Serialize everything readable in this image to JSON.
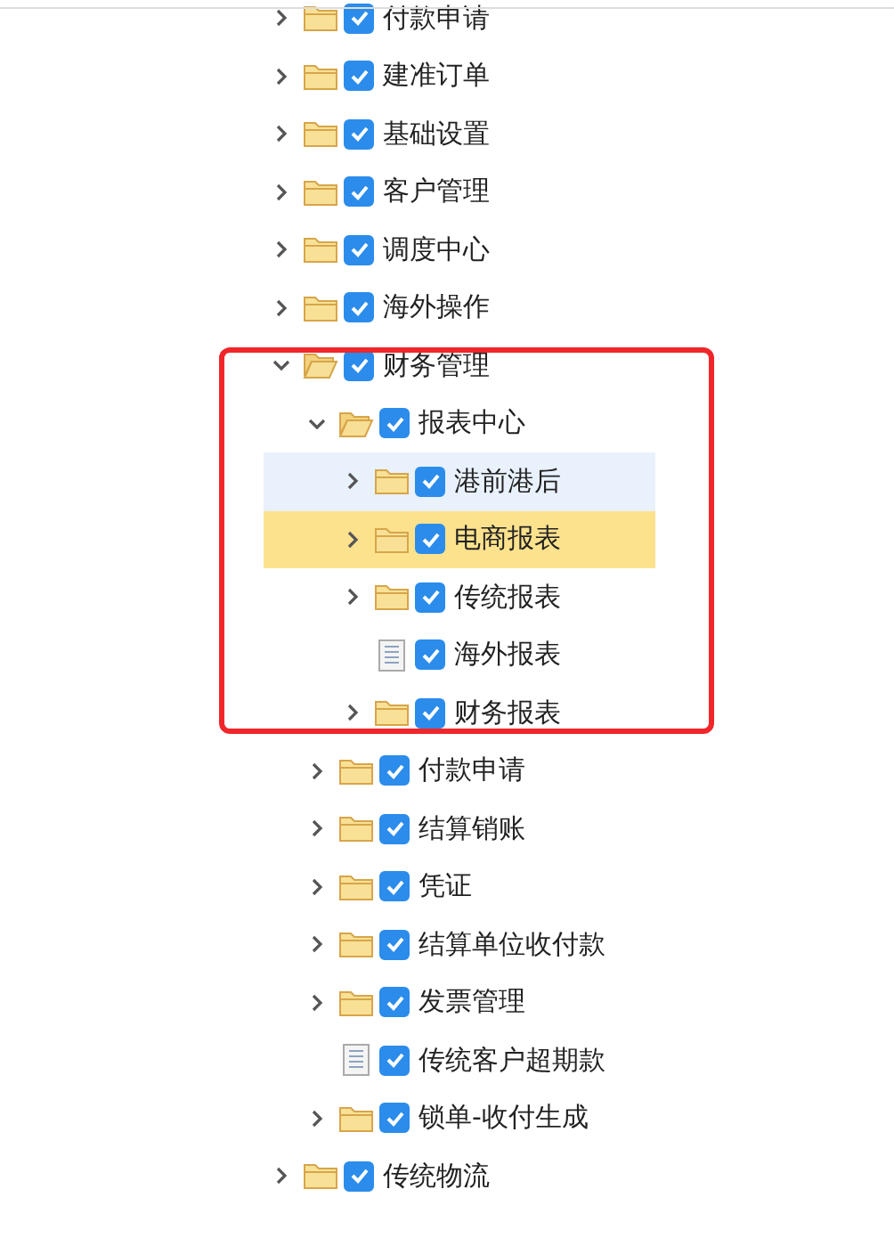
{
  "tree": [
    {
      "label": "付款申请",
      "kind": "folder",
      "expanded": false,
      "checked": true,
      "selected": false,
      "hovered": false
    },
    {
      "label": "建准订单",
      "kind": "folder",
      "expanded": false,
      "checked": true,
      "selected": false,
      "hovered": false
    },
    {
      "label": "基础设置",
      "kind": "folder",
      "expanded": false,
      "checked": true,
      "selected": false,
      "hovered": false
    },
    {
      "label": "客户管理",
      "kind": "folder",
      "expanded": false,
      "checked": true,
      "selected": false,
      "hovered": false
    },
    {
      "label": "调度中心",
      "kind": "folder",
      "expanded": false,
      "checked": true,
      "selected": false,
      "hovered": false
    },
    {
      "label": "海外操作",
      "kind": "folder",
      "expanded": false,
      "checked": true,
      "selected": false,
      "hovered": false
    },
    {
      "label": "财务管理",
      "kind": "folder",
      "expanded": true,
      "checked": true,
      "selected": false,
      "hovered": false,
      "children": [
        {
          "label": "报表中心",
          "kind": "folder",
          "expanded": true,
          "checked": true,
          "selected": false,
          "hovered": false,
          "children": [
            {
              "label": "港前港后",
              "kind": "folder",
              "expanded": false,
              "checked": true,
              "selected": false,
              "hovered": true
            },
            {
              "label": "电商报表",
              "kind": "folder",
              "expanded": false,
              "checked": true,
              "selected": true,
              "hovered": false
            },
            {
              "label": "传统报表",
              "kind": "folder",
              "expanded": false,
              "checked": true,
              "selected": false,
              "hovered": false
            },
            {
              "label": "海外报表",
              "kind": "file",
              "checked": true,
              "selected": false,
              "hovered": false
            },
            {
              "label": "财务报表",
              "kind": "folder",
              "expanded": false,
              "checked": true,
              "selected": false,
              "hovered": false
            }
          ]
        },
        {
          "label": "付款申请",
          "kind": "folder",
          "expanded": false,
          "checked": true,
          "selected": false,
          "hovered": false
        },
        {
          "label": "结算销账",
          "kind": "folder",
          "expanded": false,
          "checked": true,
          "selected": false,
          "hovered": false
        },
        {
          "label": "凭证",
          "kind": "folder",
          "expanded": false,
          "checked": true,
          "selected": false,
          "hovered": false
        },
        {
          "label": "结算单位收付款",
          "kind": "folder",
          "expanded": false,
          "checked": true,
          "selected": false,
          "hovered": false
        },
        {
          "label": "发票管理",
          "kind": "folder",
          "expanded": false,
          "checked": true,
          "selected": false,
          "hovered": false
        },
        {
          "label": "传统客户超期款",
          "kind": "file",
          "checked": true,
          "selected": false,
          "hovered": false
        },
        {
          "label": "锁单-收付生成",
          "kind": "folder",
          "expanded": false,
          "checked": true,
          "selected": false,
          "hovered": false
        }
      ]
    },
    {
      "label": "传统物流",
      "kind": "folder",
      "expanded": false,
      "checked": true,
      "selected": false,
      "hovered": false
    }
  ]
}
